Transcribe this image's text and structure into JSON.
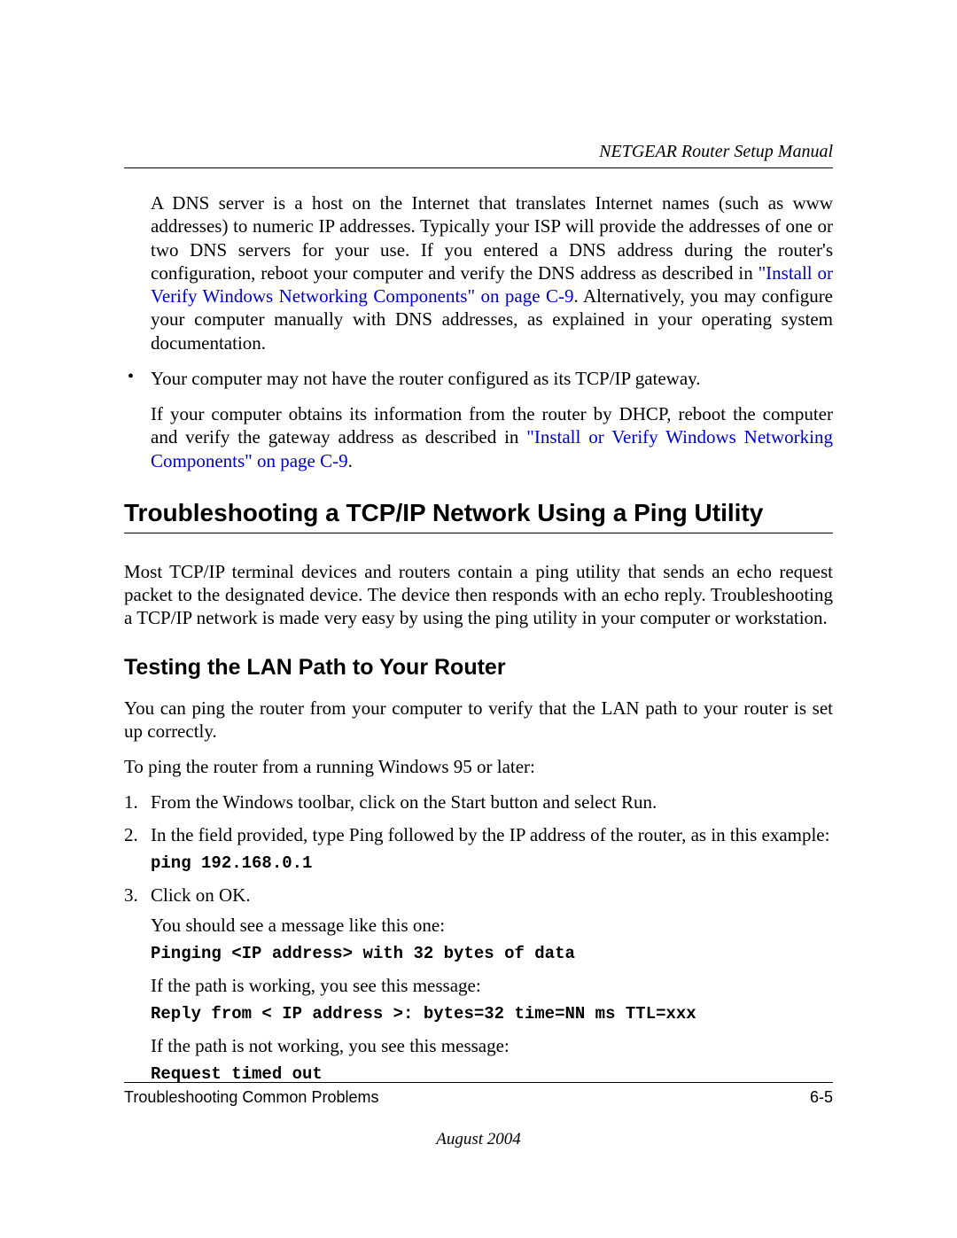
{
  "header": {
    "manual_title": "NETGEAR Router Setup Manual"
  },
  "intro": {
    "para1_a": "A DNS server is a host on the Internet that translates Internet names (such as www addresses) to numeric IP addresses. Typically your ISP will provide the addresses of one or two DNS servers for your use. If you entered a DNS address during the router's configuration, reboot your computer and verify the DNS address as described in ",
    "link1": "\"Install or Verify Windows Networking Components\" on page C-9",
    "para1_b": ". Alternatively, you may configure your computer manually with DNS addresses, as explained in your operating system documentation."
  },
  "bullet": {
    "item1": "Your computer may not have the router configured as its TCP/IP gateway.",
    "item1_detail_a": "If your computer obtains its information from the router by DHCP, reboot the computer and verify the gateway address as described in ",
    "link2": "\"Install or Verify Windows Networking Components\" on page C-9",
    "item1_detail_b": "."
  },
  "section1": {
    "title": "Troubleshooting a TCP/IP Network Using a Ping Utility",
    "para": "Most TCP/IP terminal devices and routers contain a ping utility that sends an echo request packet to the designated device. The device then responds with an echo reply. Troubleshooting a TCP/IP network is made very easy by using the ping utility in your computer or workstation."
  },
  "subsection1": {
    "title": "Testing the LAN Path to Your Router",
    "para1": "You can ping the router from your computer to verify that the LAN path to your router is set up correctly.",
    "para2": "To ping the router from a running Windows 95 or later:",
    "steps": [
      "From the Windows toolbar, click on the Start button and select Run.",
      "In the field provided, type Ping followed by the IP address of the router, as in this example:",
      "Click on OK."
    ],
    "code1": "ping 192.168.0.1",
    "step3_p1": "You should see a message like this one:",
    "code2": "Pinging <IP address> with 32 bytes of data",
    "step3_p2": "If the path is working, you see this message:",
    "code3": "Reply from < IP address >: bytes=32 time=NN ms TTL=xxx",
    "step3_p3": "If the path is not working, you see this message:",
    "code4": "Request timed out"
  },
  "footer": {
    "chapter": "Troubleshooting Common Problems",
    "page": "6-5",
    "date": "August 2004"
  }
}
